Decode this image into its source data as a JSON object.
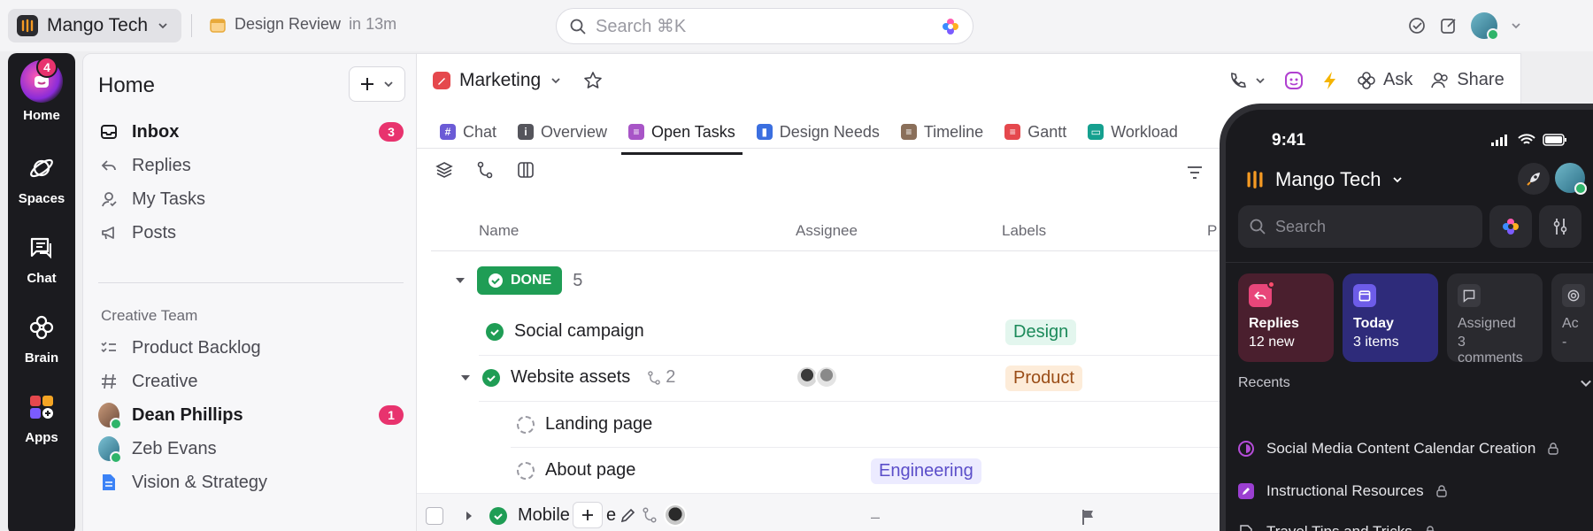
{
  "topbar": {
    "workspace": "Mango Tech",
    "meeting_title": "Design Review",
    "meeting_time": "in 13m",
    "search_placeholder": "Search ⌘K"
  },
  "rail": {
    "items": [
      {
        "label": "Home",
        "icon": "home-icon",
        "badge": "4"
      },
      {
        "label": "Spaces",
        "icon": "planet-icon"
      },
      {
        "label": "Chat",
        "icon": "chat-icon"
      },
      {
        "label": "Brain",
        "icon": "brain-icon"
      },
      {
        "label": "Apps",
        "icon": "apps-icon"
      }
    ]
  },
  "sidebar": {
    "title": "Home",
    "items": [
      {
        "label": "Inbox",
        "icon": "inbox-icon",
        "count": "3"
      },
      {
        "label": "Replies",
        "icon": "reply-icon"
      },
      {
        "label": "My Tasks",
        "icon": "person-icon"
      },
      {
        "label": "Posts",
        "icon": "megaphone-icon"
      }
    ],
    "section_title": "Creative Team",
    "team_items": [
      {
        "label": "Product Backlog",
        "icon": "checklist-icon"
      },
      {
        "label": "Creative",
        "icon": "hash-icon"
      },
      {
        "label": "Dean Phillips",
        "icon": "avatar",
        "count": "1"
      },
      {
        "label": "Zeb Evans",
        "icon": "avatar"
      },
      {
        "label": "Vision & Strategy",
        "icon": "doc-icon"
      }
    ]
  },
  "main": {
    "list_name": "Marketing",
    "actions": {
      "ask": "Ask",
      "share": "Share"
    },
    "tabs": [
      {
        "label": "Chat",
        "color": "#6b5bd6",
        "glyph": "#"
      },
      {
        "label": "Overview",
        "color": "#55555c",
        "glyph": "i"
      },
      {
        "label": "Open Tasks",
        "color": "#a855c7",
        "glyph": "≡"
      },
      {
        "label": "Design Needs",
        "color": "#3b6fe0",
        "glyph": "▮"
      },
      {
        "label": "Timeline",
        "color": "#8a6f5a",
        "glyph": "≡"
      },
      {
        "label": "Gantt",
        "color": "#e5484d",
        "glyph": "≡"
      },
      {
        "label": "Workload",
        "color": "#15a08f",
        "glyph": "▭"
      }
    ],
    "columns": {
      "name": "Name",
      "assignee": "Assignee",
      "labels": "Labels",
      "p": "P"
    },
    "group": {
      "status": "DONE",
      "count": "5"
    },
    "rows": {
      "social": "Social campaign",
      "website": "Website assets",
      "website_subtasks": "2",
      "landing": "Landing page",
      "about": "About page",
      "mobile": "Mobile",
      "mobile_rest": "e",
      "dash": "–"
    },
    "tags": {
      "design": "Design",
      "product": "Product",
      "engineering": "Engineering"
    }
  },
  "phone": {
    "time": "9:41",
    "workspace": "Mango Tech",
    "search_placeholder": "Search",
    "cards": [
      {
        "title": "Replies",
        "sub": "12 new",
        "bg": "#4a1f2e",
        "accent": "#e8467a"
      },
      {
        "title": "Today",
        "sub": "3 items",
        "bg": "#2e2b7a",
        "accent": "#6d5ce8"
      },
      {
        "title": "Assigned",
        "sub": "3 comments",
        "bg": "#2a2a2f",
        "accent": "#3a3a40"
      },
      {
        "title": "Ac",
        "sub": "-",
        "bg": "#2a2a2f",
        "accent": "#3a3a40"
      }
    ],
    "recents_title": "Recents",
    "recents": [
      {
        "label": "Social Media Content Calendar Creation",
        "color": "#b44cd8"
      },
      {
        "label": "Instructional Resources",
        "color": "#9b3fd1"
      },
      {
        "label": "Travel Tips and Tricks",
        "color": "#c8c8cf"
      }
    ]
  }
}
